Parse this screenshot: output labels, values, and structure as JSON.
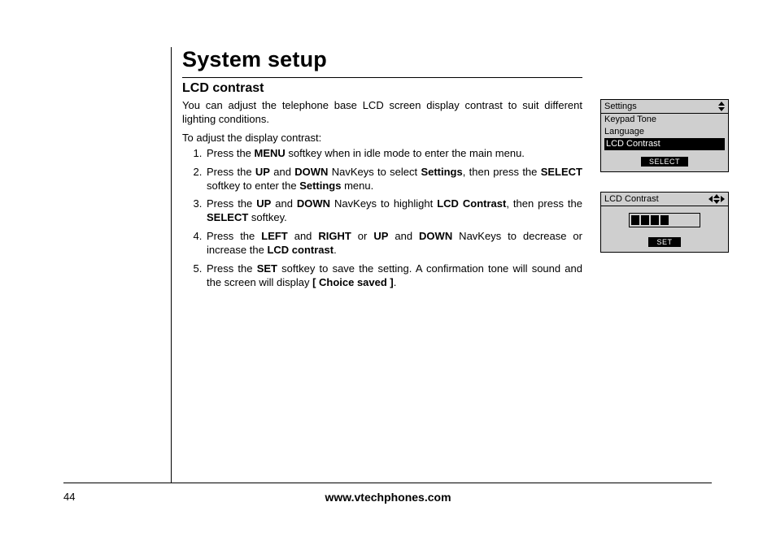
{
  "page": {
    "number": "44",
    "footer_url": "www.vtechphones.com",
    "title": "System setup",
    "section": "LCD contrast",
    "intro": "You can adjust the telephone base LCD screen display contrast to suit different lighting conditions.",
    "lead": "To adjust the display contrast:",
    "steps": [
      {
        "pre": "Press the ",
        "b1": "MENU",
        "post": " softkey when in idle mode to enter the main menu."
      },
      {
        "pre": "Press the ",
        "b1": "UP",
        "mid1": " and ",
        "b2": "DOWN",
        "mid2": " NavKeys to select ",
        "b3": "Settings",
        "mid3": ", then press the ",
        "b4": "SELECT",
        "mid4": " softkey to enter the ",
        "b5": "Settings",
        "post": " menu."
      },
      {
        "pre": "Press the ",
        "b1": "UP",
        "mid1": " and ",
        "b2": "DOWN",
        "mid2": " NavKeys to highlight ",
        "b3": "LCD Contrast",
        "mid3": ", then press the ",
        "b4": "SELECT",
        "post": " softkey."
      },
      {
        "pre": "Press the ",
        "b1": "LEFT",
        "mid1": " and ",
        "b2": "RIGHT",
        "mid2": " or ",
        "b3": "UP",
        "mid3": " and ",
        "b4": "DOWN",
        "mid4": " NavKeys to decrease or increase the ",
        "b5": "LCD contrast",
        "post": "."
      },
      {
        "pre": "Press the ",
        "b1": "SET",
        "mid1": " softkey to save the setting. A confirmation tone will sound and the screen will display ",
        "b2": "[ Choice saved ]",
        "post": "."
      }
    ]
  },
  "lcd1": {
    "title": "Settings",
    "items": [
      "Keypad Tone",
      "Language",
      "LCD Contrast"
    ],
    "highlight_index": 2,
    "softkey": "SELECT"
  },
  "lcd2": {
    "title": "LCD Contrast",
    "filled_segments": 4,
    "total_segments": 7,
    "softkey": "SET"
  }
}
